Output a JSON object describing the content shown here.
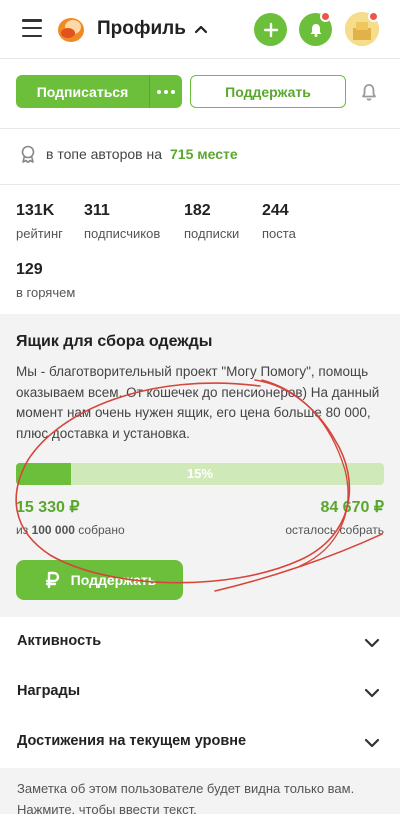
{
  "header": {
    "title": "Профиль",
    "icons": {
      "menu": "hamburger-menu-icon",
      "logo": "pikabu-logo-icon",
      "expand": "chevron-up-icon",
      "add": "plus-icon",
      "notifications": "bell-icon",
      "avatar": "user-avatar"
    }
  },
  "actions": {
    "subscribe_label": "Подписаться",
    "more_icon": "more-dots-icon",
    "support_label": "Поддержать",
    "notify_icon": "bell-outline-icon"
  },
  "rank": {
    "prefix": "в топе авторов на",
    "position": "715 месте",
    "icon": "medal-icon"
  },
  "stats": [
    {
      "value": "131K",
      "label": "рейтинг"
    },
    {
      "value": "311",
      "label": "подписчиков"
    },
    {
      "value": "182",
      "label": "подписки"
    },
    {
      "value": "244",
      "label": "поста"
    },
    {
      "value": "129",
      "label": "в горячем"
    }
  ],
  "fundraiser": {
    "title": "Ящик для сбора одежды",
    "description": "Мы - благотворительный проект \"Могу Помогу\", помощь оказываем всем. От кошечек до пенсионеров) На данный момент нам очень нужен ящик, его цена больше 80 000, плюс доставка и установка.",
    "progress_percent": 15,
    "progress_label": "15%",
    "collected": "15 330 ₽",
    "goal_prefix": "из",
    "goal": "100 000",
    "goal_suffix": "собрано",
    "remaining": "84 670 ₽",
    "remaining_label": "осталось собрать",
    "button_label": "Поддержать",
    "button_icon": "ruble-icon"
  },
  "sections": [
    {
      "label": "Активность"
    },
    {
      "label": "Награды"
    },
    {
      "label": "Достижения на текущем уровне"
    }
  ],
  "note": {
    "text": "Заметка об этом пользователе будет видна только вам. Нажмите, чтобы ввести текст."
  },
  "colors": {
    "accent": "#6bbf3a",
    "accent_text": "#5aa72e",
    "annotation": "#d6453a",
    "badge": "#ee5544"
  }
}
